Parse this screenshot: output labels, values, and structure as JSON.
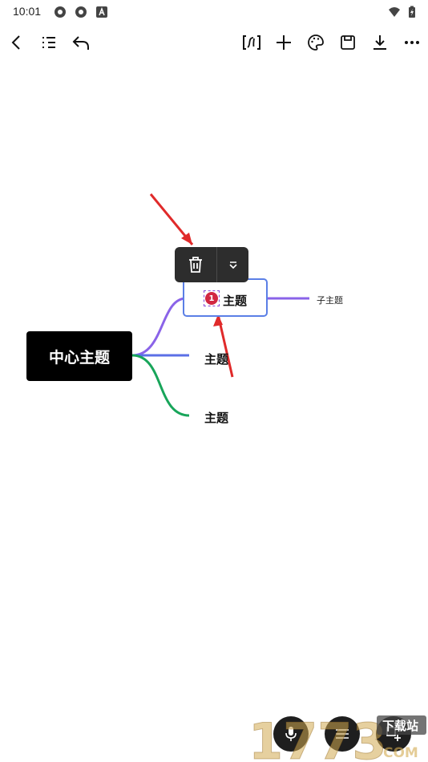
{
  "status_bar": {
    "time": "10:01",
    "icons": [
      "app-icon-1",
      "app-icon-2",
      "a-icon",
      "wifi-icon",
      "battery-icon"
    ]
  },
  "toolbar": {
    "left": [
      "back-icon",
      "outline-list-icon",
      "undo-icon"
    ],
    "right": [
      "formula-icon",
      "add-icon",
      "palette-icon",
      "save-icon",
      "download-icon",
      "more-icon"
    ],
    "formula_label": "[0]"
  },
  "popup": {
    "items": [
      "delete-icon",
      "expand-down-icon"
    ]
  },
  "mindmap": {
    "center_topic": "中心主题",
    "topics": [
      "主题",
      "主题",
      "主题"
    ],
    "subtopic": "子主题",
    "marker_number": "1",
    "branch_colors": [
      "#8a63e8",
      "#5b6fe6",
      "#18a55a"
    ]
  },
  "watermark": {
    "text": "1773",
    "subtitle": "下载站",
    "domain": "COM"
  },
  "fabs": [
    "mic-icon",
    "layout-icon",
    "add-node-icon"
  ]
}
